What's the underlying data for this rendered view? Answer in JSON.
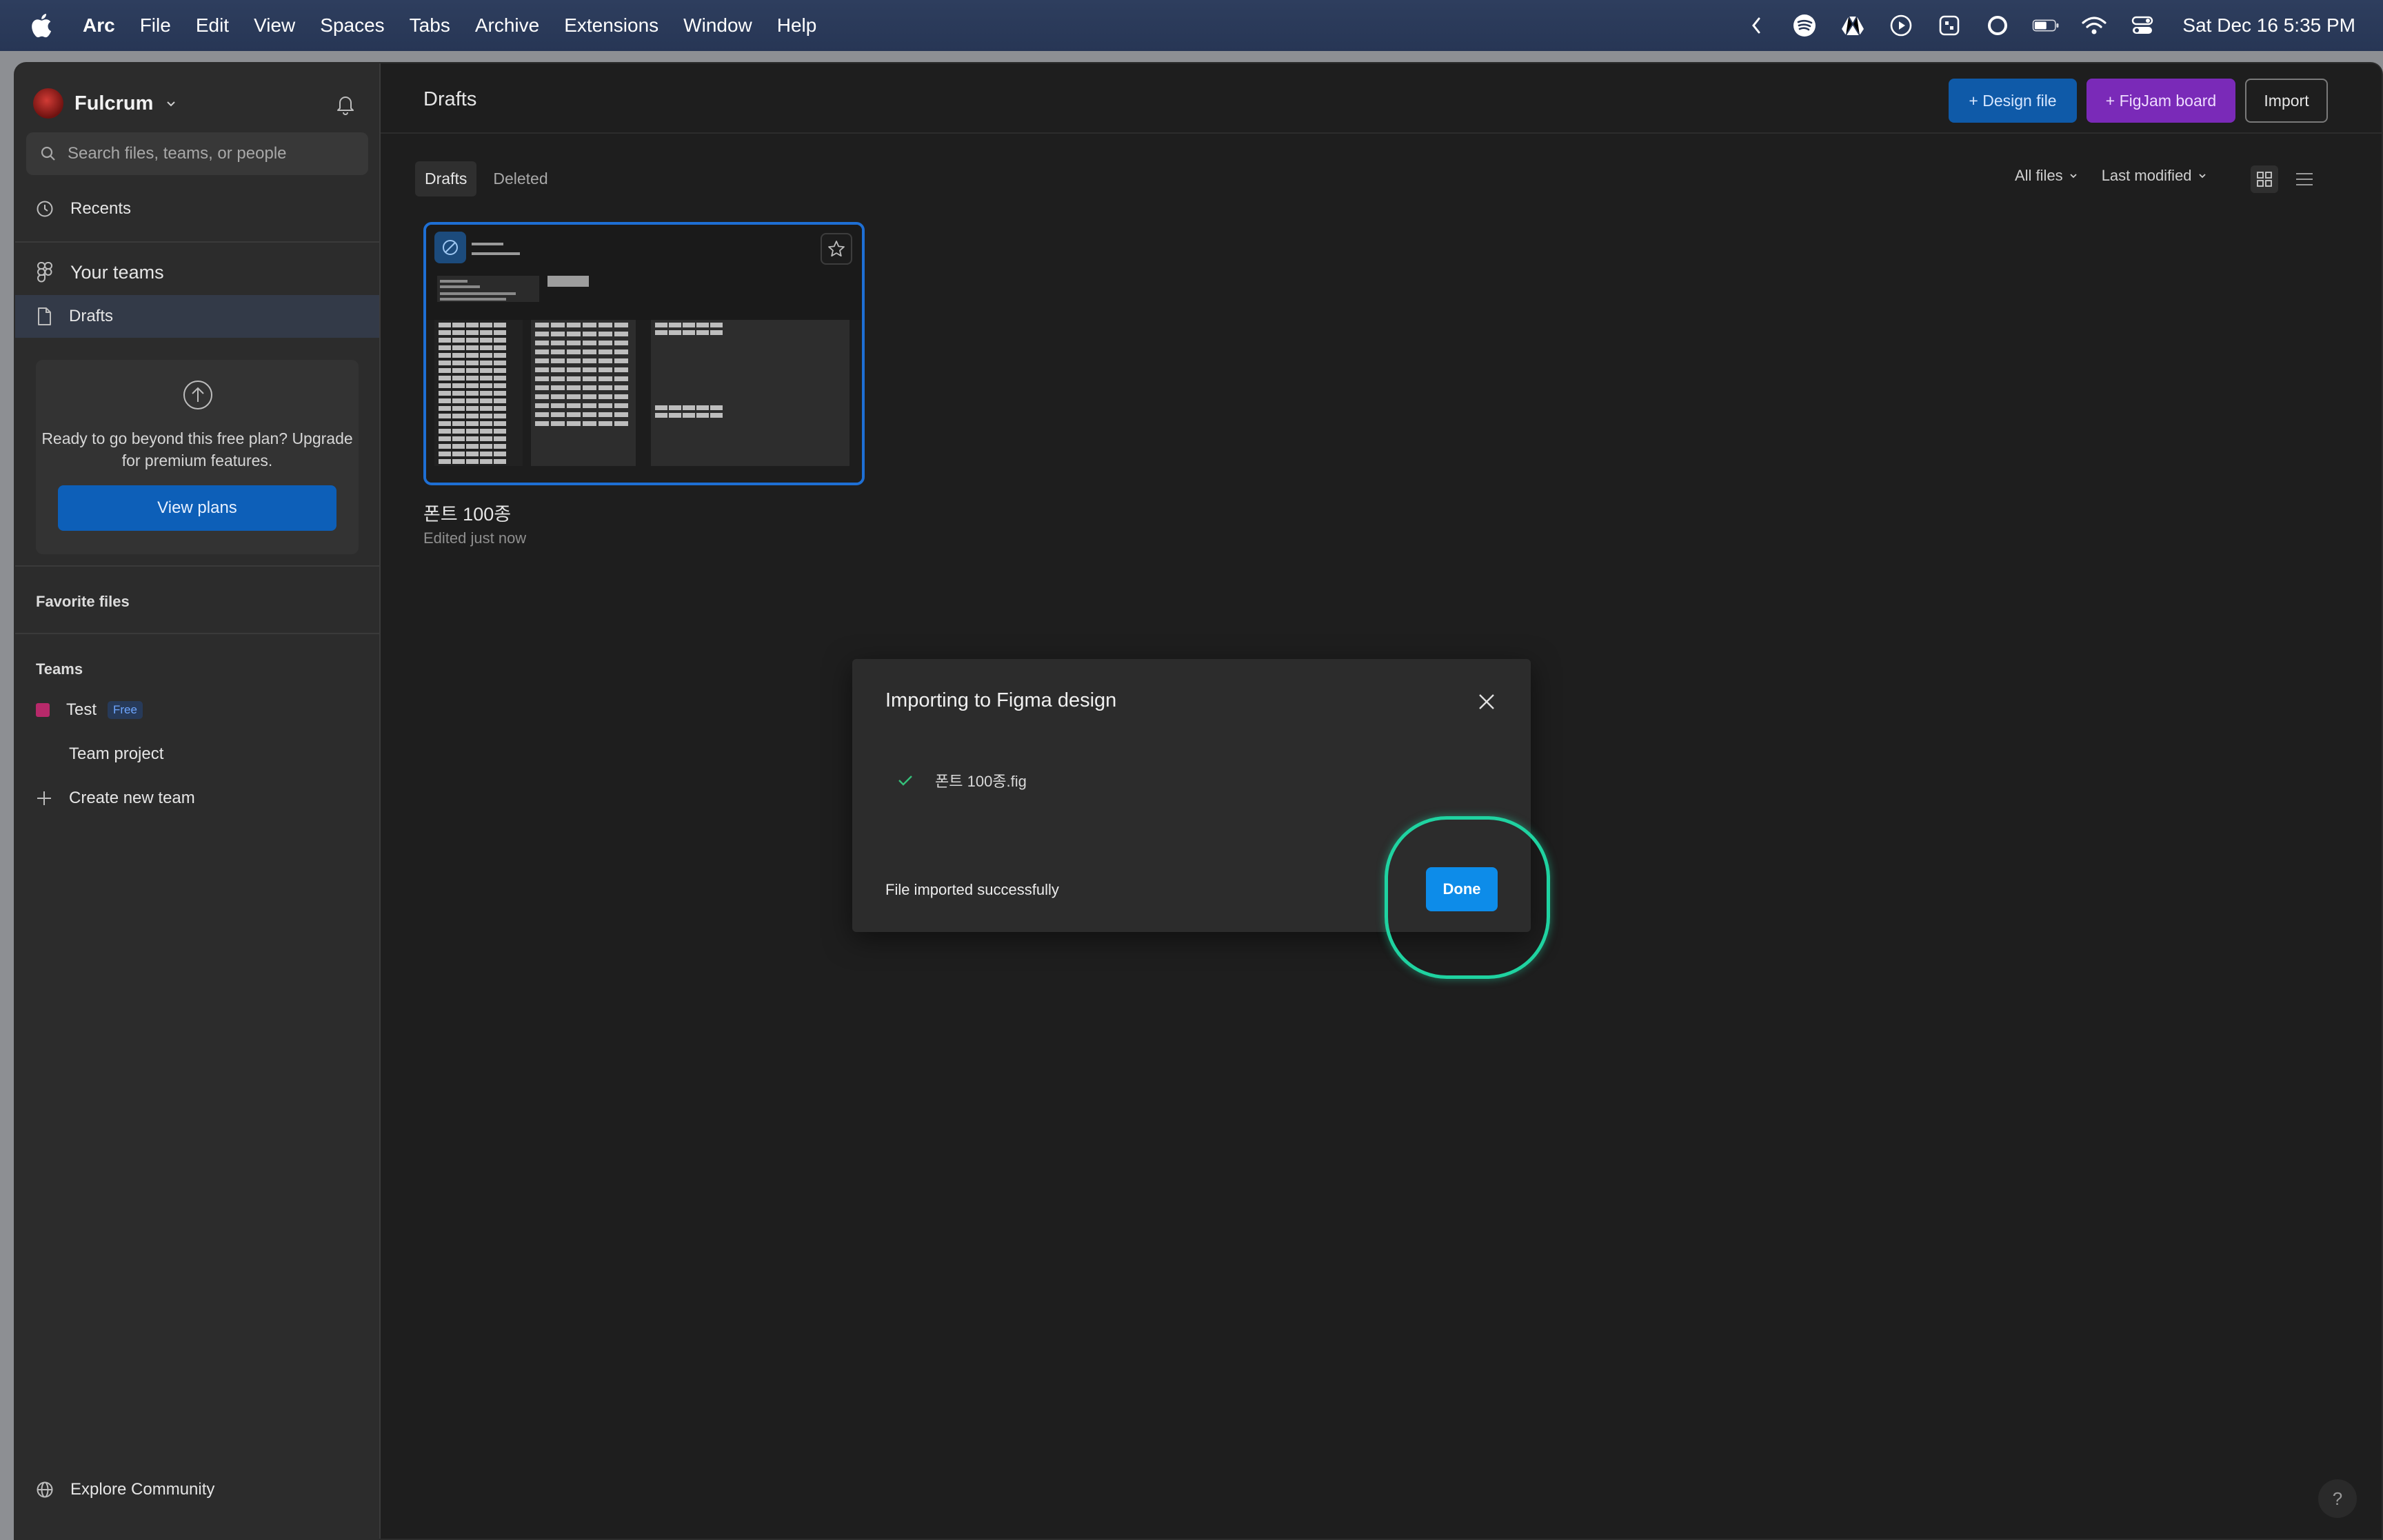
{
  "menubar": {
    "app": "Arc",
    "items": [
      "File",
      "Edit",
      "View",
      "Spaces",
      "Tabs",
      "Archive",
      "Extensions",
      "Window",
      "Help"
    ],
    "clock": "Sat Dec 16  5:35 PM"
  },
  "sidebar": {
    "org_name": "Fulcrum",
    "search_placeholder": "Search files, teams, or people",
    "recents": "Recents",
    "your_teams": "Your teams",
    "drafts": "Drafts",
    "upgrade_text": "Ready to go beyond this free plan? Upgrade for premium features.",
    "view_plans": "View plans",
    "favorite_files": "Favorite files",
    "teams_label": "Teams",
    "team_name": "Test",
    "team_badge": "Free",
    "team_project": "Team project",
    "create_team": "Create new team",
    "explore": "Explore Community"
  },
  "main": {
    "title": "Drafts",
    "design_file": "+ Design file",
    "figjam_board": "+ FigJam board",
    "import": "Import",
    "tabs": [
      "Drafts",
      "Deleted"
    ],
    "filter_files": "All files",
    "sort": "Last modified",
    "file": {
      "name": "폰트 100종",
      "meta": "Edited just now"
    },
    "help": "?"
  },
  "modal": {
    "title": "Importing to Figma design",
    "file": "폰트 100종.fig",
    "status": "File imported successfully",
    "done": "Done"
  },
  "colors": {
    "accent": "#0d8ce9",
    "highlight": "#1fd3a1",
    "figjam": "#7a2ab8"
  }
}
